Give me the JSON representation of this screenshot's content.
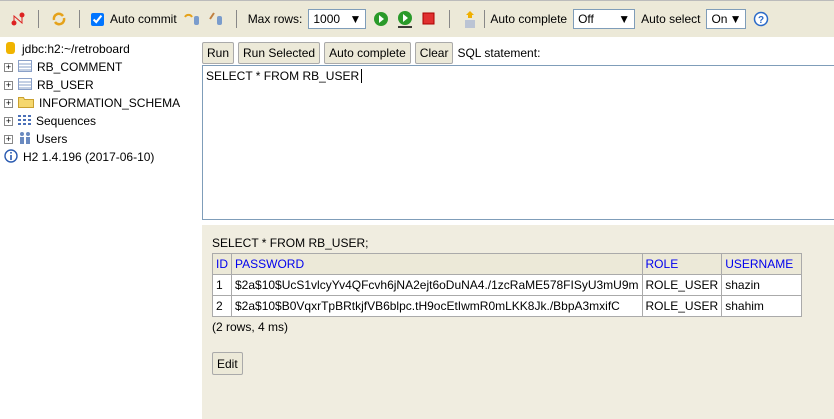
{
  "toolbar": {
    "auto_commit": "Auto commit",
    "auto_commit_checked": true,
    "max_rows_label": "Max rows:",
    "max_rows": "1000",
    "auto_complete_label": "Auto complete",
    "auto_complete": "Off",
    "auto_select_label": "Auto select",
    "auto_select": "On"
  },
  "tree": {
    "connection": "jdbc:h2:~/retroboard",
    "items": [
      {
        "label": "RB_COMMENT"
      },
      {
        "label": "RB_USER"
      },
      {
        "label": "INFORMATION_SCHEMA"
      },
      {
        "label": "Sequences"
      },
      {
        "label": "Users"
      }
    ],
    "version": "H2 1.4.196 (2017-06-10)"
  },
  "buttons": {
    "run": "Run",
    "run_selected": "Run Selected",
    "auto_complete": "Auto complete",
    "clear": "Clear",
    "sql_label": "SQL statement:"
  },
  "editor": {
    "sql": "SELECT * FROM RB_USER"
  },
  "results": {
    "query": "SELECT * FROM RB_USER;",
    "columns": [
      "ID",
      "PASSWORD",
      "ROLE",
      "USERNAME"
    ],
    "rows": [
      [
        "1",
        "$2a$10$UcS1vlcyYv4QFcvh6jNA2ejt6oDuNA4./1zcRaME578FISyU3mU9m",
        "ROLE_USER",
        "shazin"
      ],
      [
        "2",
        "$2a$10$B0VqxrTpBRtkjfVB6blpc.tH9ocEtIwmR0mLKK8Jk./BbpA3mxifC",
        "ROLE_USER",
        "shahim"
      ]
    ],
    "summary": "(2 rows, 4 ms)",
    "edit": "Edit"
  }
}
